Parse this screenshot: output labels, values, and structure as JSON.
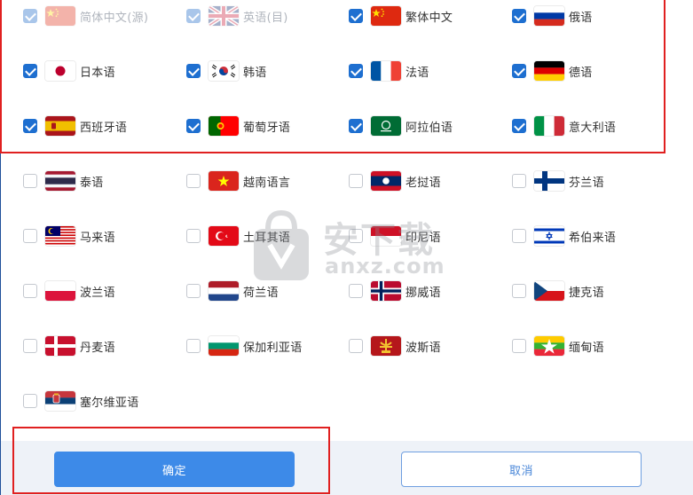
{
  "languages": [
    {
      "label": "简体中文(源)",
      "checked": true,
      "disabled": true,
      "flag": "flag-cn"
    },
    {
      "label": "英语(目)",
      "checked": true,
      "disabled": true,
      "flag": "flag-uk"
    },
    {
      "label": "繁体中文",
      "checked": true,
      "disabled": false,
      "flag": "flag-cn"
    },
    {
      "label": "俄语",
      "checked": true,
      "disabled": false,
      "flag": "flag-ru"
    },
    {
      "label": "日本语",
      "checked": true,
      "disabled": false,
      "flag": "flag-jp"
    },
    {
      "label": "韩语",
      "checked": true,
      "disabled": false,
      "flag": "flag-kr"
    },
    {
      "label": "法语",
      "checked": true,
      "disabled": false,
      "flag": "flag-fr"
    },
    {
      "label": "德语",
      "checked": true,
      "disabled": false,
      "flag": "flag-de"
    },
    {
      "label": "西班牙语",
      "checked": true,
      "disabled": false,
      "flag": "flag-es"
    },
    {
      "label": "葡萄牙语",
      "checked": true,
      "disabled": false,
      "flag": "flag-pt"
    },
    {
      "label": "阿拉伯语",
      "checked": true,
      "disabled": false,
      "flag": "flag-sa"
    },
    {
      "label": "意大利语",
      "checked": true,
      "disabled": false,
      "flag": "flag-it"
    },
    {
      "label": "泰语",
      "checked": false,
      "disabled": false,
      "flag": "flag-th"
    },
    {
      "label": "越南语言",
      "checked": false,
      "disabled": false,
      "flag": "flag-vn"
    },
    {
      "label": "老挝语",
      "checked": false,
      "disabled": false,
      "flag": "flag-la"
    },
    {
      "label": "芬兰语",
      "checked": false,
      "disabled": false,
      "flag": "flag-fi"
    },
    {
      "label": "马来语",
      "checked": false,
      "disabled": false,
      "flag": "flag-my"
    },
    {
      "label": "土耳其语",
      "checked": false,
      "disabled": false,
      "flag": "flag-tr"
    },
    {
      "label": "印尼语",
      "checked": false,
      "disabled": false,
      "flag": "flag-id"
    },
    {
      "label": "希伯来语",
      "checked": false,
      "disabled": false,
      "flag": "flag-il"
    },
    {
      "label": "波兰语",
      "checked": false,
      "disabled": false,
      "flag": "flag-pl"
    },
    {
      "label": "荷兰语",
      "checked": false,
      "disabled": false,
      "flag": "flag-nl"
    },
    {
      "label": "挪威语",
      "checked": false,
      "disabled": false,
      "flag": "flag-no"
    },
    {
      "label": "捷克语",
      "checked": false,
      "disabled": false,
      "flag": "flag-cz"
    },
    {
      "label": "丹麦语",
      "checked": false,
      "disabled": false,
      "flag": "flag-dk"
    },
    {
      "label": "保加利亚语",
      "checked": false,
      "disabled": false,
      "flag": "flag-bg"
    },
    {
      "label": "波斯语",
      "checked": false,
      "disabled": false,
      "flag": "flag-ir"
    },
    {
      "label": "缅甸语",
      "checked": false,
      "disabled": false,
      "flag": "flag-mm"
    },
    {
      "label": "塞尔维亚语",
      "checked": false,
      "disabled": false,
      "flag": "flag-rs"
    }
  ],
  "buttons": {
    "ok_label": "确定",
    "cancel_label": "取消"
  },
  "watermark": {
    "text": "安下载",
    "sub": "anxz.com"
  },
  "colors": {
    "accent": "#3d8ae8",
    "checkbox": "#1e6fd0",
    "highlight": "#e02020",
    "footer": "#eef2f8"
  }
}
